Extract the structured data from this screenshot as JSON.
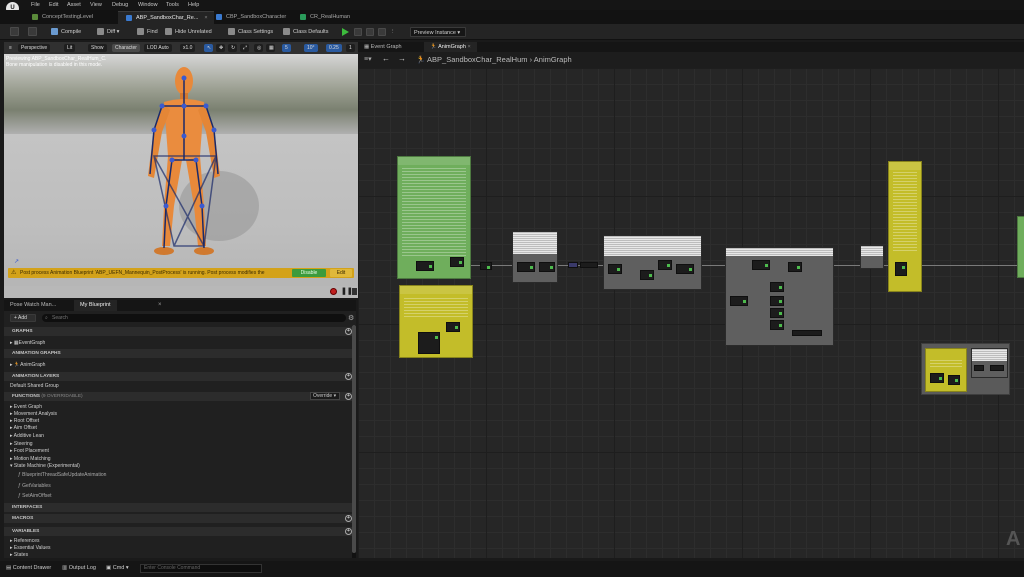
{
  "menu": [
    "File",
    "Edit",
    "Asset",
    "View",
    "Debug",
    "Window",
    "Tools",
    "Help"
  ],
  "tabs": [
    {
      "label": "ConceptTestingLevel",
      "color": "#5a8a3a"
    },
    {
      "label": "ABP_SandboxChar_Re...",
      "color": "#3a7ad0"
    },
    {
      "label": "CBP_SandboxCharacter",
      "color": "#3a7ad0"
    },
    {
      "label": "CR_RealHuman",
      "color": "#2a9a5a"
    }
  ],
  "toolbar": {
    "compile": "Compile",
    "diff": "Diff",
    "find": "Find",
    "hide_unrelated": "Hide Unrelated",
    "class_settings": "Class Settings",
    "class_defaults": "Class Defaults",
    "preview": "Preview Instance"
  },
  "viewport": {
    "perspective": "Perspective",
    "lit": "Lit",
    "show": "Show",
    "character": "Character",
    "lod": "LOD Auto",
    "speed": "x1.0",
    "grid": "5",
    "angle": "10°",
    "scale": "0.25",
    "camera": "1",
    "preview_line1": "Previewing ABP_SandboxChar_RealHum_C.",
    "preview_line2": "Bone manipulation is disabled in this mode.",
    "warning": "Post process Animation Blueprint 'ABP_UEFN_Mannequin_PostProcess' is running. Post process modifies the",
    "warn_btn1": "Disable",
    "warn_btn2": "Edit"
  },
  "blueprint": {
    "tab1": "Pose Watch Man...",
    "tab2": "My Blueprint",
    "add": "+ Add",
    "search_placeholder": "Search",
    "graphs_title": "GRAPHS",
    "event_graph": "EventGraph",
    "anim_graphs_title": "ANIMATION GRAPHS",
    "anim_graph": "AnimGraph",
    "layers_title": "ANIMATION LAYERS",
    "default_group": "Default Shared Group",
    "functions_title": "FUNCTIONS",
    "functions_count": "(9 OVERRIDABLE)",
    "override": "Override",
    "functions": [
      "Event Graph",
      "Movement Analysis",
      "Root Offset",
      "Aim Offset",
      "Additive Lean",
      "Steering",
      "Foot Placement",
      "Motion Matching",
      "State Machine (Experimental)"
    ],
    "fn_items": [
      "BlueprintThreadSafeUpdateAnimation",
      "GetVariables",
      "SetAimOffset"
    ],
    "interfaces": "INTERFACES",
    "macros": "MACROS",
    "variables": "VARIABLES",
    "var_groups": [
      "References",
      "Essential Values",
      "States"
    ]
  },
  "graph": {
    "tab1": "Event Graph",
    "tab2": "AnimGraph",
    "breadcrumb_root": "ABP_SandboxChar_RealHum",
    "breadcrumb_sep": "›",
    "breadcrumb_leaf": "AnimGraph",
    "watermark": "A"
  },
  "status": {
    "drawer": "Content Drawer",
    "log": "Output Log",
    "cmd": "Cmd",
    "cmd_placeholder": "Enter Console Command"
  },
  "colors": {
    "green_comment": "#6fae5c",
    "yellow_comment": "#c3bd29",
    "accent": "#3a7ad0",
    "warn": "#d3a21a"
  }
}
